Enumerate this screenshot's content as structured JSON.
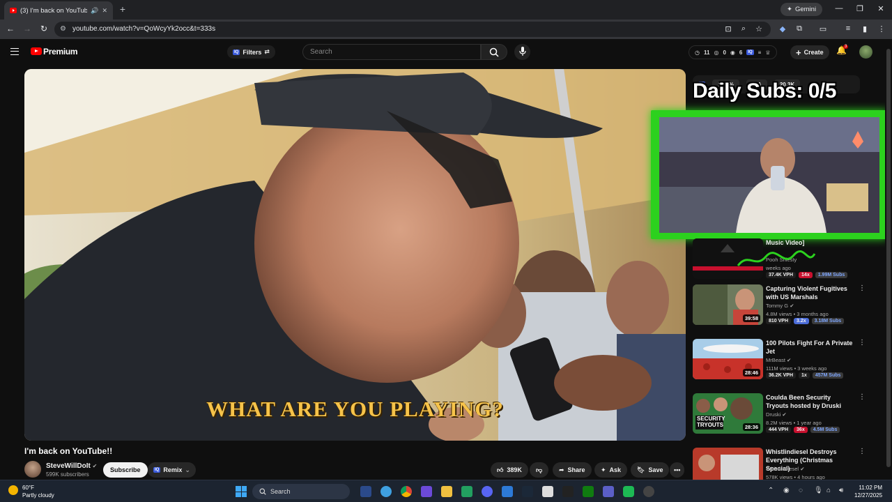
{
  "browser": {
    "tab_title": "(3) I'm back on YouTube!! -",
    "gemini_label": "Gemini",
    "url": "youtube.com/watch?v=QoWcyYk2occ&t=333s"
  },
  "header": {
    "brand": "Premium",
    "filters_label": "Filters",
    "search_placeholder": "Search",
    "stats": [
      "11",
      "0",
      "6"
    ],
    "create_label": "Create",
    "notification_count": "3"
  },
  "video": {
    "caption": "WHAT ARE YOU PLAYING?",
    "title": "I'm back on YouTube!!",
    "channel": "SteveWillDoIt",
    "subscribers": "599K subscribers",
    "subscribe_label": "Subscribe",
    "remix_label": "Remix",
    "likes": "389K",
    "share_label": "Share",
    "ask_label": "Ask",
    "save_label": "Save"
  },
  "overlay": {
    "stat_values": [
      "14.1%",
      "N/A",
      "20.3K"
    ],
    "daily_subs": "Daily Subs: 0/5"
  },
  "recommendations": [
    {
      "title": "Music Video]",
      "channel": "Pooh Shiesty",
      "meta": "weeks ago",
      "badges": [
        "37.4K VPH",
        "14x",
        "1.99M Subs"
      ],
      "duration": "",
      "thumb_color": "#1a1a1a"
    },
    {
      "title": "Capturing Violent Fugitives with US Marshals",
      "channel": "Tommy G",
      "meta": "4.8M views • 3 months ago",
      "badges": [
        "810 VPH",
        "3.2x",
        "3.18M Subs"
      ],
      "duration": "39:58",
      "thumb_color": "#5a6b4a"
    },
    {
      "title": "100 Pilots Fight For A Private Jet",
      "channel": "MrBeast",
      "meta": "111M views • 3 weeks ago",
      "badges": [
        "36.2K VPH",
        "1x",
        "457M Subs"
      ],
      "duration": "28:46",
      "thumb_color": "#a7cce6"
    },
    {
      "title": "Coulda Been Security Tryouts hosted by Druski",
      "channel": "Druski",
      "meta": "8.2M views • 1 year ago",
      "badges": [
        "444 VPH",
        "36x",
        "4.5M Subs"
      ],
      "duration": "28:36",
      "thumb_color": "#2f7a3a"
    },
    {
      "title": "Whistlindiesel Destroys Everything (Christmas Special)",
      "channel": "WhistlinDiesel",
      "meta": "578K views • 4 hours ago",
      "badges": [],
      "duration": "",
      "thumb_color": "#b83a2a"
    }
  ],
  "taskbar": {
    "temperature": "60°F",
    "weather": "Partly cloudy",
    "search_label": "Search",
    "time": "11:02 PM",
    "date": "12/27/2025"
  }
}
